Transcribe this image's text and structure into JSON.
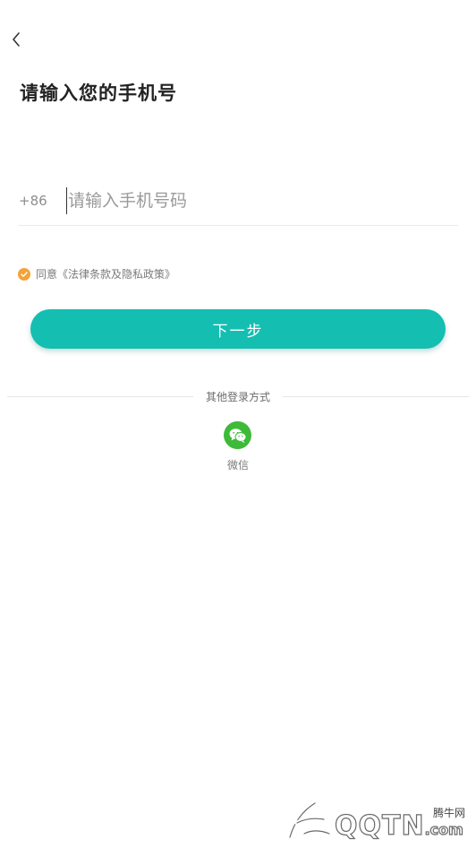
{
  "header": {
    "back_icon": "chevron-left-icon",
    "title": "请输入您的手机号"
  },
  "phone": {
    "country_code": "+86",
    "placeholder": "请输入手机号码",
    "value": ""
  },
  "agreement": {
    "checked": true,
    "check_icon": "check-circle-icon",
    "text": "同意《法律条款及隐私政策》"
  },
  "next_button": {
    "label": "下一步"
  },
  "other_login": {
    "divider_text": "其他登录方式",
    "wechat": {
      "icon": "wechat-icon",
      "label": "微信"
    }
  },
  "watermark": {
    "cn": "腾牛网",
    "en_main": "QQTN",
    "en_suffix": ".com"
  },
  "colors": {
    "accent": "#14bfb2",
    "check": "#f2a33a",
    "wechat": "#3dbb38",
    "text_primary": "#222222",
    "text_secondary": "#7a7a7a",
    "divider": "#e6e6e6"
  }
}
